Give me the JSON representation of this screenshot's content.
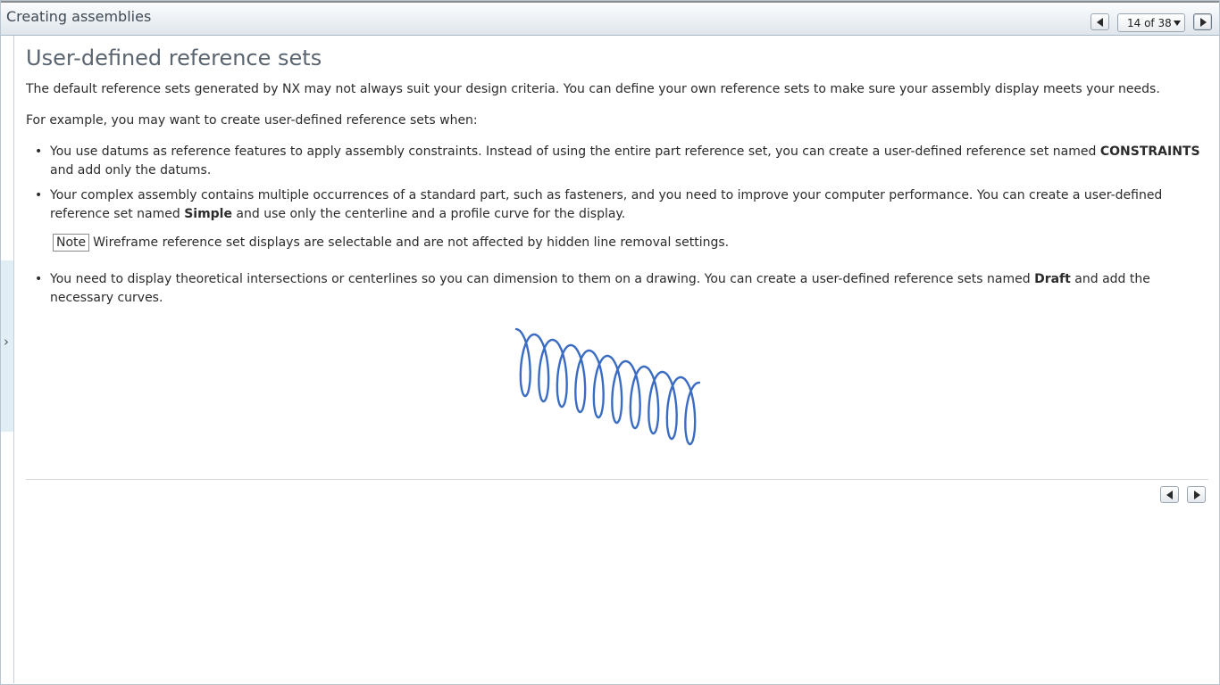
{
  "header": {
    "title": "Creating assemblies",
    "page_indicator": "14 of 38",
    "prev_icon": "triangle-left-icon",
    "next_icon": "triangle-right-icon"
  },
  "sidebar": {
    "expand_icon": "chevron-right-icon"
  },
  "main": {
    "heading": "User-defined reference sets",
    "intro": "The default reference sets generated by NX may not always suit your design criteria. You can define your own reference sets to make sure your assembly display meets your needs.",
    "example_lead": "For example, you may want to create user-defined reference sets when:",
    "bullet1": {
      "pre": "You use datums as reference features to apply assembly constraints. Instead of using the entire part reference set, you can create a user-defined reference set named ",
      "bold": "CONSTRAINTS",
      "post": " and add only the datums."
    },
    "bullet2": {
      "pre": "Your complex assembly contains multiple occurrences of a standard part, such as fasteners, and you need to improve your computer performance. You can create a user-defined reference set named ",
      "bold": "Simple",
      "post": " and use only the centerline and a profile curve for the display."
    },
    "note": {
      "label": "Note",
      "text": "Wireframe reference set displays are selectable and are not affected by hidden line removal settings."
    },
    "bullet3": {
      "pre": "You need to display theoretical intersections or centerlines so you can dimension to them on a drawing. You can create a user-defined reference sets named ",
      "bold": "Draft",
      "post": " and add the necessary curves."
    },
    "figure_color": "#3b6cc4"
  },
  "colors": {
    "header_gradient_top": "#fbfcfd",
    "header_gradient_bottom": "#dfe6ec",
    "heading": "#5a6570",
    "rail_highlight": "#e2eef6"
  }
}
